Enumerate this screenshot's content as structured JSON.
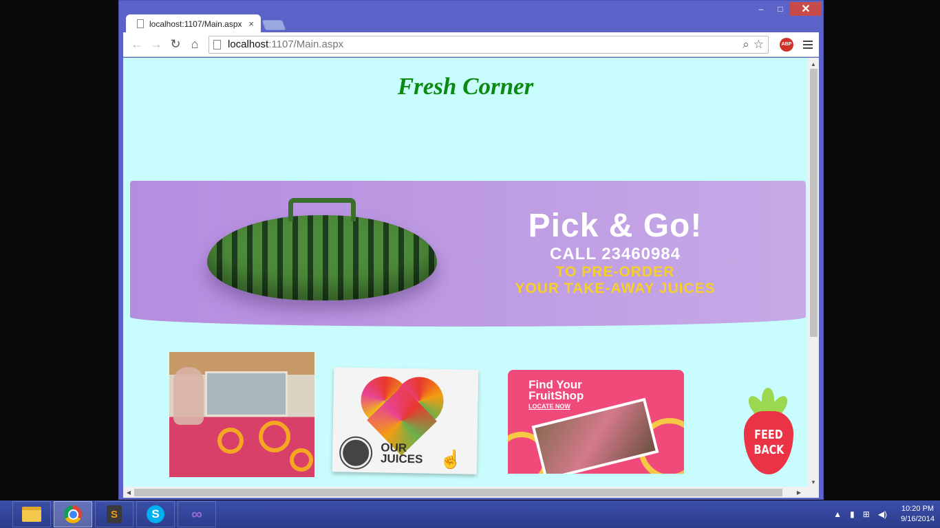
{
  "browser": {
    "tab_title": "localhost:1107/Main.aspx",
    "tab_close": "×",
    "url_host": "localhost",
    "url_path": ":1107/Main.aspx",
    "controls": {
      "minimize": "–",
      "maximize": "□",
      "close": "✕"
    },
    "nav": {
      "back": "←",
      "forward": "→",
      "reload": "↻",
      "home": "⌂"
    },
    "zoom_icon": "⌕",
    "star_icon": "☆",
    "abp_label": "ABP"
  },
  "page": {
    "title": "Fresh Corner",
    "banner": {
      "headline": "Pick & Go!",
      "call": "CALL 23460984",
      "line1": "TO PRE-ORDER",
      "line2": "YOUR TAKE-AWAY JUICES"
    },
    "tiles": {
      "juices_label_1": "OUR",
      "juices_label_2": "JUICES",
      "fruitshop_title_1": "Find Your",
      "fruitshop_title_2": "FruitShop",
      "fruitshop_link": "LOCATE NOW",
      "feedback_1": "FEED",
      "feedback_2": "BACK"
    },
    "colors": {
      "background": "#c9fdfd",
      "title": "#0a8a12",
      "banner": "#b58de0",
      "accent_yellow": "#f6cf2a"
    }
  },
  "taskbar": {
    "apps": [
      "file-explorer",
      "chrome",
      "sublime-text",
      "skype",
      "visual-studio"
    ],
    "sublime_glyph": "S",
    "skype_glyph": "S",
    "vs_glyph": "∞",
    "tray_caret": "▲",
    "tray_icons": [
      "battery",
      "network",
      "volume"
    ],
    "time": "10:20 PM",
    "date": "9/16/2014"
  },
  "scroll": {
    "up": "▲",
    "down": "▼",
    "left": "◀",
    "right": "▶"
  }
}
